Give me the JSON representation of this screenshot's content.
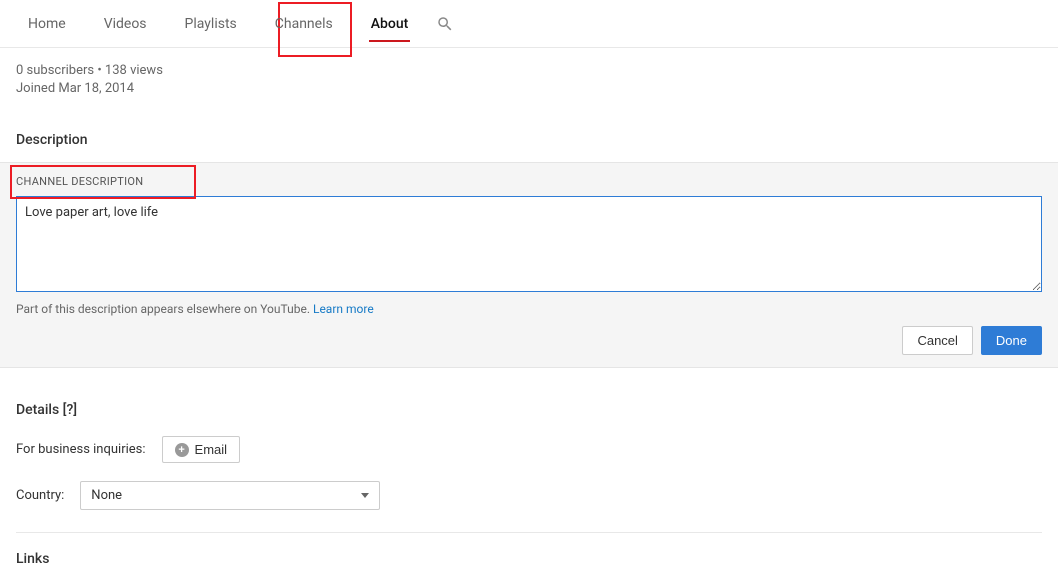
{
  "tabs": {
    "home": "Home",
    "videos": "Videos",
    "playlists": "Playlists",
    "channels": "Channels",
    "about": "About"
  },
  "stats": {
    "line": "0 subscribers • 138 views",
    "joined": "Joined Mar 18, 2014"
  },
  "description": {
    "section_title": "Description",
    "label": "CHANNEL DESCRIPTION",
    "value": "Love paper art, love life",
    "note_prefix": "Part of this description appears elsewhere on YouTube. ",
    "learn_more": "Learn more",
    "cancel": "Cancel",
    "done": "Done"
  },
  "details": {
    "section_title": "Details [?]",
    "business_label": "For business inquiries:",
    "email_btn": "Email",
    "country_label": "Country:",
    "country_value": "None"
  },
  "links": {
    "section_title": "Links"
  }
}
